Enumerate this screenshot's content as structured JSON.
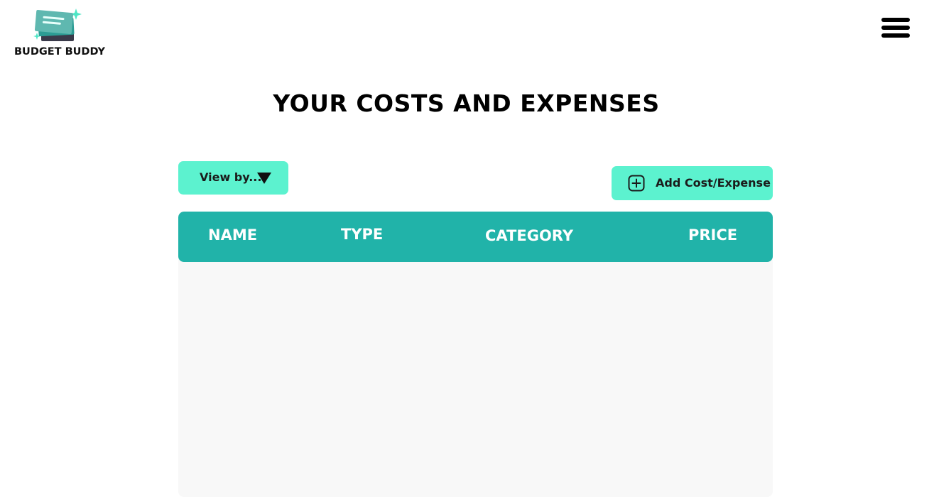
{
  "header": {
    "logo_text": "BUDGET BUDDY"
  },
  "page": {
    "title": "YOUR COSTS AND EXPENSES"
  },
  "controls": {
    "view_by_label": "View by...",
    "add_label": "Add Cost/Expense"
  },
  "table": {
    "columns": [
      "NAME",
      "TYPE",
      "CATEGORY",
      "PRICE"
    ],
    "rows": []
  },
  "colors": {
    "accent": "#5cf2cf",
    "table_header": "#21b3a9",
    "table_body": "#f8f8f8"
  },
  "icons": {
    "logo": "stacked-cards-logo",
    "menu": "hamburger-menu-icon",
    "dropdown": "triangle-down-icon",
    "add": "plus-square-icon"
  }
}
